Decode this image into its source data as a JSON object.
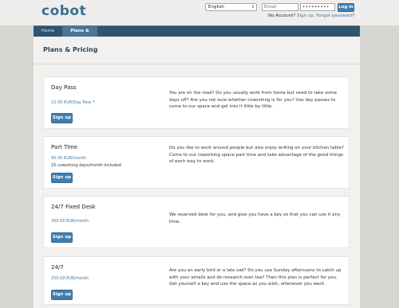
{
  "header": {
    "logo": "cobot",
    "language": "English",
    "email_placeholder": "Email",
    "password_value": "•••••••••",
    "login_label": "Log in",
    "no_account": "No Account?",
    "signup_link": "Sign up.",
    "forgot_link": "Forgot password?"
  },
  "nav": {
    "tabs": [
      "Home",
      "Plans & Pricing"
    ],
    "active": "Plans & Pricing"
  },
  "page": {
    "title": "Plans & Pricing"
  },
  "plans": [
    {
      "name": "Day Pass",
      "price": "15.00 EUR/Day Pass",
      "asterisk": "*",
      "extra": "",
      "description": "You are on the road? Do you usually work from home but need to take some days off? Are you not sure whether coworking is for you? Use day passes to come to our space and get into it little by little.",
      "button": "Sign up"
    },
    {
      "name": "Part Time",
      "price": "95.00 EUR/month",
      "asterisk": "",
      "extra": "15 coworking days/month included",
      "description": "Do you like to work around people but also enjoy writing on your kitchen table? Come to our coworking space part time and take advantage of the good things of each way to work.",
      "button": "Sign up"
    },
    {
      "name": "24/7 Fixed Desk",
      "price": "200.00 EUR/month",
      "asterisk": "",
      "extra": "",
      "description": "We reserved desk for you, and give you have a key so that you can use it any time.",
      "button": "Sign up"
    },
    {
      "name": "24/7",
      "price": "250.00 EUR/month",
      "asterisk": "",
      "extra": "",
      "description": "Are you an early bird or a late owl? Do you use Sunday afternoons to catch up with your emails and do research over tea? Then this plan is perfect for you. Get yourself a key and use the space as you wish, whenever you want.",
      "button": "Sign up"
    }
  ],
  "colors": {
    "accent": "#3f7fae",
    "nav_background": "#2e5470",
    "link": "#3e78a6"
  }
}
